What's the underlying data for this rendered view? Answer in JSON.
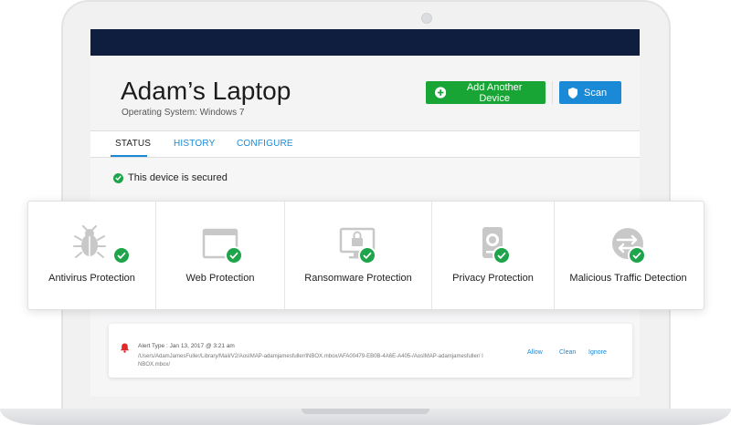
{
  "device": {
    "title": "Adam’s Laptop",
    "os_line": "Operating System: Windows 7"
  },
  "buttons": {
    "add_device": "Add Another Device",
    "scan": "Scan"
  },
  "tabs": [
    {
      "label": "STATUS",
      "active": true
    },
    {
      "label": "HISTORY",
      "active": false
    },
    {
      "label": "CONFIGURE",
      "active": false
    }
  ],
  "status_message": "This device is secured",
  "protections": [
    {
      "label": "Antivirus Protection",
      "icon": "bug-icon"
    },
    {
      "label": "Web Protection",
      "icon": "browser-window-icon"
    },
    {
      "label": "Ransomware Protection",
      "icon": "locked-monitor-icon"
    },
    {
      "label": "Privacy Protection",
      "icon": "webcam-icon"
    },
    {
      "label": "Malicious Traffic Detection",
      "icon": "traffic-arrows-icon"
    }
  ],
  "alert": {
    "type_line": "Alert Type : Jan 13, 2017 @ 3:21 am",
    "path": "/Users/AdamJamesFuller/Library/Mail/V2/AosIMAP-adamjamesfuller/INBOX.mbox/AFA00479-EB0B-4A6E-A405-/AosIMAP-adamjamesfuller/ INBOX.mbox/",
    "actions": {
      "allow": "Allow",
      "clean": "Clean",
      "ignore": "Ignore"
    }
  },
  "colors": {
    "navy_bar": "#0f1d3f",
    "green": "#19a436",
    "blue": "#1a8ad6",
    "check_green": "#1ea44a",
    "alert_red": "#e0292b"
  }
}
